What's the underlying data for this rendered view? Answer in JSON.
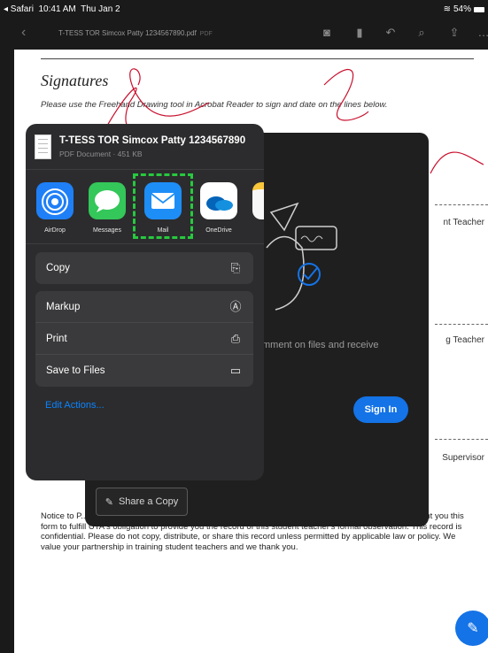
{
  "status_bar": {
    "back_app": "◂ Safari",
    "time": "10:41 AM",
    "date": "Thu Jan 2",
    "battery": "54%"
  },
  "toolbar": {
    "title": "T-TESS TOR Simcox Patty 1234567890.pdf",
    "file_type": "PDF"
  },
  "document": {
    "heading": "Signatures",
    "instructions": "Please use the Freehand Drawing tool in Acrobat Reader to sign and date on the lines below.",
    "role_labels": [
      "nt Teacher",
      "g Teacher",
      "Supervisor"
    ],
    "notice": "Notice to P... The UT Arlington COEd Field Supervisor or other COEd Field Office representative has sent you this form to fulfill UTA's obligation to provide you the record of this student teacher's formal observation. This record is confidential. Please do not copy, distribute, or share this record unless permitted by applicable law or policy. We value your partnership in training student teachers and we thank you."
  },
  "acrobat_modal": {
    "message": "mment on files and receive",
    "sign_in": "Sign In",
    "share_copy": "Share a Copy"
  },
  "share_sheet": {
    "file_name": "T-TESS TOR Simcox Patty 1234567890",
    "file_meta": "PDF Document · 451 KB",
    "apps": [
      {
        "label": "AirDrop",
        "icon": "airdrop-icon"
      },
      {
        "label": "Messages",
        "icon": "messages-icon"
      },
      {
        "label": "Mail",
        "icon": "mail-icon"
      },
      {
        "label": "OneDrive",
        "icon": "onedrive-icon"
      },
      {
        "label": "",
        "icon": "notes-icon"
      }
    ],
    "actions_group1": [
      {
        "label": "Copy",
        "icon": "copy-icon"
      }
    ],
    "actions_group2": [
      {
        "label": "Markup",
        "icon": "markup-icon"
      },
      {
        "label": "Print",
        "icon": "print-icon"
      },
      {
        "label": "Save to Files",
        "icon": "folder-icon"
      }
    ],
    "edit_actions": "Edit Actions..."
  }
}
